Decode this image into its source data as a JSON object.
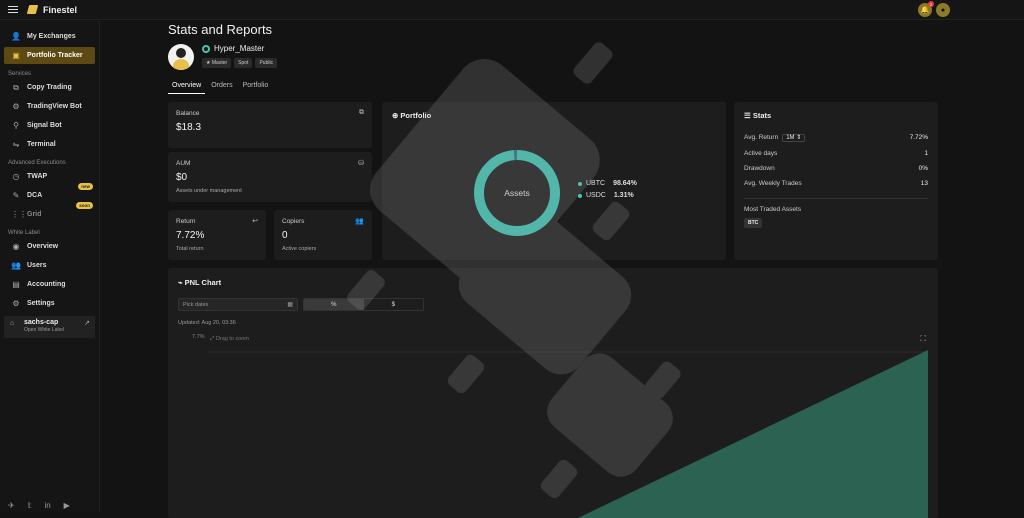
{
  "app": {
    "name": "Finestel"
  },
  "topbar": {
    "notif_count": "2"
  },
  "sidebar": {
    "top_items": [
      {
        "label": "My Exchanges",
        "icon": "users-icon"
      },
      {
        "label": "Portfolio Tracker",
        "icon": "briefcase-icon"
      }
    ],
    "services_title": "Services",
    "services": [
      {
        "label": "Copy Trading"
      },
      {
        "label": "TradingView Bot"
      },
      {
        "label": "Signal Bot"
      },
      {
        "label": "Terminal"
      }
    ],
    "advanced_title": "Advanced Executions",
    "advanced": [
      {
        "label": "TWAP"
      },
      {
        "label": "DCA",
        "badge": "new"
      },
      {
        "label": "Grid",
        "badge": "soon"
      }
    ],
    "white_label_title": "White Label",
    "white_label": [
      {
        "label": "Overview"
      },
      {
        "label": "Users"
      },
      {
        "label": "Accounting"
      },
      {
        "label": "Settings"
      }
    ],
    "workspace": {
      "name": "sachs-cap",
      "action": "Open White Label"
    }
  },
  "page": {
    "title": "Stats and Reports"
  },
  "profile": {
    "username": "Hyper_Master",
    "chips": [
      "Master",
      "Spot",
      "Public"
    ]
  },
  "tabs": [
    "Overview",
    "Orders",
    "Portfolio"
  ],
  "balance": {
    "label": "Balance",
    "value": "$18.3"
  },
  "aum": {
    "label": "AUM",
    "value": "$0",
    "sub": "Assets under management"
  },
  "return": {
    "label": "Return",
    "value": "7.72%",
    "sub": "Total return"
  },
  "copiers": {
    "label": "Copiers",
    "value": "0",
    "sub": "Active copiers"
  },
  "portfolio": {
    "title": "Portfolio",
    "center_label": "Assets",
    "assets": [
      {
        "name": "UBTC",
        "pct": "98.64%",
        "value": 98.64
      },
      {
        "name": "USDC",
        "pct": "1.31%",
        "value": 1.31
      }
    ],
    "colors": {
      "primary": "#3fbfb0",
      "secondary": "#2e6e8a"
    }
  },
  "stats": {
    "title": "Stats",
    "avg_return_label": "Avg. Return",
    "period": "1M",
    "avg_return": "7.72%",
    "active_days_label": "Active days",
    "active_days": "1",
    "drawdown_label": "Drawdown",
    "drawdown": "0%",
    "weekly_trades_label": "Avg. Weekly Trades",
    "weekly_trades": "13",
    "most_traded_label": "Most Traded Assets",
    "most_traded": "BTC"
  },
  "pnl": {
    "title": "PNL Chart",
    "date_placeholder": "Pick dates",
    "mode_pct": "%",
    "mode_usd": "$",
    "updated": "Updated: Aug 20, 03:36",
    "y_label": "7.7%",
    "drag_hint": "Drag to zoom",
    "fill_color": "#2e6e5a"
  }
}
